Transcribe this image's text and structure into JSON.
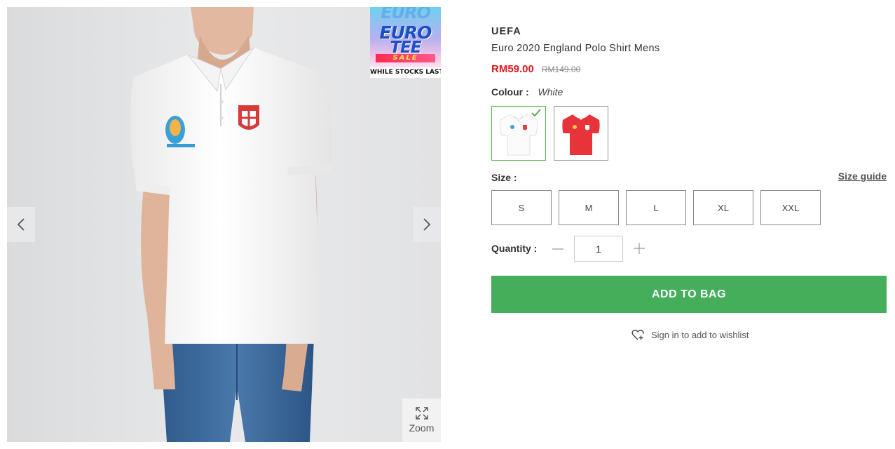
{
  "gallery": {
    "zoom_label": "Zoom",
    "promo": {
      "ghost": "EURO",
      "euro": "EURO",
      "tee": "TEE",
      "sale": "SALE",
      "strip": "WHILE STOCKS LAST"
    }
  },
  "product": {
    "brand": "UEFA",
    "title": "Euro 2020 England Polo Shirt Mens",
    "price": "RM59.00",
    "old_price": "RM149.00",
    "colour_label": "Colour :",
    "colour_value": "White",
    "colours": [
      {
        "name": "White",
        "hex": "#ffffff",
        "selected": true
      },
      {
        "name": "Red",
        "hex": "#e8333b",
        "selected": false
      }
    ],
    "size_label": "Size :",
    "size_guide": "Size guide",
    "sizes": [
      "S",
      "M",
      "L",
      "XL",
      "XXL"
    ],
    "quantity_label": "Quantity :",
    "quantity": "1",
    "add_to_bag": "ADD TO BAG",
    "wishlist": "Sign in to add to wishlist"
  },
  "colors": {
    "price_red": "#e0151f",
    "button_green": "#44ae5a",
    "check_green": "#5cae4f"
  },
  "icons": {
    "prev": "chevron-left-icon",
    "next": "chevron-right-icon",
    "zoom": "expand-icon",
    "check": "checkmark-icon",
    "minus": "minus-icon",
    "plus": "plus-icon",
    "wishlist": "heart-plus-icon"
  }
}
